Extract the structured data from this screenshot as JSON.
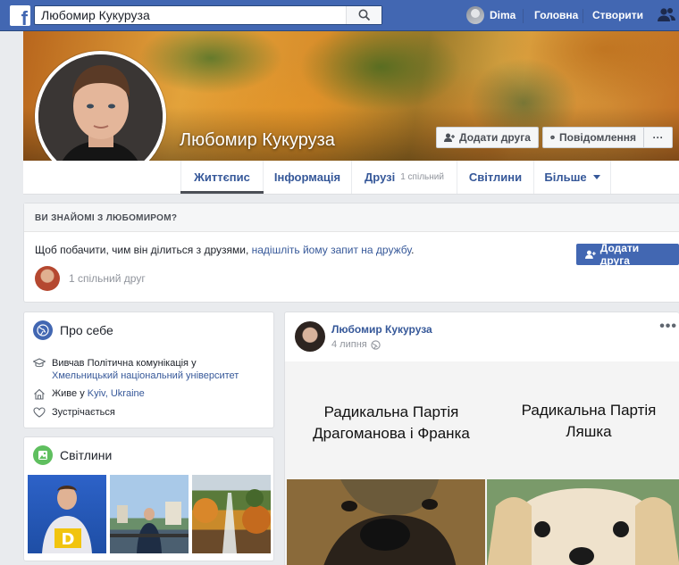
{
  "topbar": {
    "brand_letter": "f",
    "search_value": "Любомир Кукуруза",
    "user_name": "Dima",
    "nav_home": "Головна",
    "nav_create": "Створити"
  },
  "profile": {
    "name": "Любомир Кукуруза",
    "add_friend": "Додати друга",
    "message": "Повідомлення",
    "more": "···"
  },
  "tabs": {
    "timeline": "Життєпис",
    "about": "Інформація",
    "friends": "Друзі",
    "friends_mutual": "1 спільний",
    "photos": "Світлини",
    "more": "Більше"
  },
  "know": {
    "heading": "ВИ ЗНАЙОМІ З ЛЮБОМИРОМ?",
    "text_before": "Щоб побачити, чим він ділиться з друзями, ",
    "text_link": "надішліть йому запит на дружбу",
    "text_after": ".",
    "add_friend": "Додати друга",
    "mutual": "1 спільний друг"
  },
  "about": {
    "title": "Про себе",
    "study_prefix": "Вивчав Політична комунікація у",
    "study_school": "Хмельницький національний університет",
    "lives_prefix": "Живе у",
    "lives_place": "Kyiv, Ukraine",
    "relationship": "Зустрічається"
  },
  "photos": {
    "title": "Світлини"
  },
  "post": {
    "author": "Любомир Кукуруза",
    "date": "4 липня",
    "more": "•••",
    "left_caption_1": "Радикальна Партія",
    "left_caption_2": "Драгоманова і Франка",
    "right_caption_1": "Радикальна Партія",
    "right_caption_2": "Ляшка"
  },
  "colors": {
    "brand_blue": "#4267b2",
    "link_blue": "#365899",
    "page_bg": "#e9ebee"
  }
}
